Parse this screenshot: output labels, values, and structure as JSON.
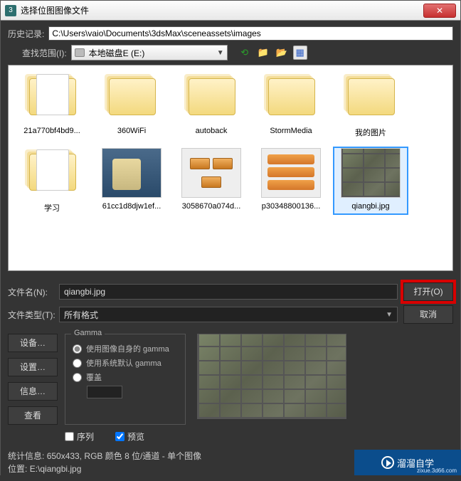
{
  "title": "选择位图图像文件",
  "history_label": "历史记录:",
  "history_path": "C:\\Users\\vaio\\Documents\\3dsMax\\sceneassets\\images",
  "scope_label": "查找范围(I):",
  "scope_value": "本地磁盘E (E:)",
  "files": [
    {
      "name": "21a770bf4bd9...",
      "type": "folder",
      "paper": true
    },
    {
      "name": "360WiFi",
      "type": "folder"
    },
    {
      "name": "autoback",
      "type": "folder"
    },
    {
      "name": "StormMedia",
      "type": "folder"
    },
    {
      "name": "我的图片",
      "type": "folder"
    },
    {
      "name": "学习",
      "type": "folder",
      "paper": true
    },
    {
      "name": "61cc1d8djw1ef...",
      "type": "image",
      "thumb": "person"
    },
    {
      "name": "3058670a074d...",
      "type": "image",
      "thumb": "batt"
    },
    {
      "name": "p30348800136...",
      "type": "image",
      "thumb": "boxes"
    },
    {
      "name": "qiangbi.jpg",
      "type": "image",
      "thumb": "bricks",
      "selected": true,
      "highlighted": true
    }
  ],
  "filename_label": "文件名(N):",
  "filename_value": "qiangbi.jpg",
  "filetype_label": "文件类型(T):",
  "filetype_value": "所有格式",
  "open_btn": "打开(O)",
  "cancel_btn": "取消",
  "left_buttons": [
    "设备…",
    "设置…",
    "信息…",
    "查看"
  ],
  "gamma_legend": "Gamma",
  "gamma_opts": [
    "使用图像自身的 gamma",
    "使用系统默认 gamma",
    "覆盖"
  ],
  "seq_label": "序列",
  "preview_label": "预览",
  "stats_label": "统计信息:",
  "stats_value": "650x433, RGB 颜色 8 位/通道 - 单个图像",
  "loc_label": "位置:",
  "loc_value": "E:\\qiangbi.jpg",
  "watermark_main": "溜溜自学",
  "watermark_sub": "zixue.3d66.com"
}
